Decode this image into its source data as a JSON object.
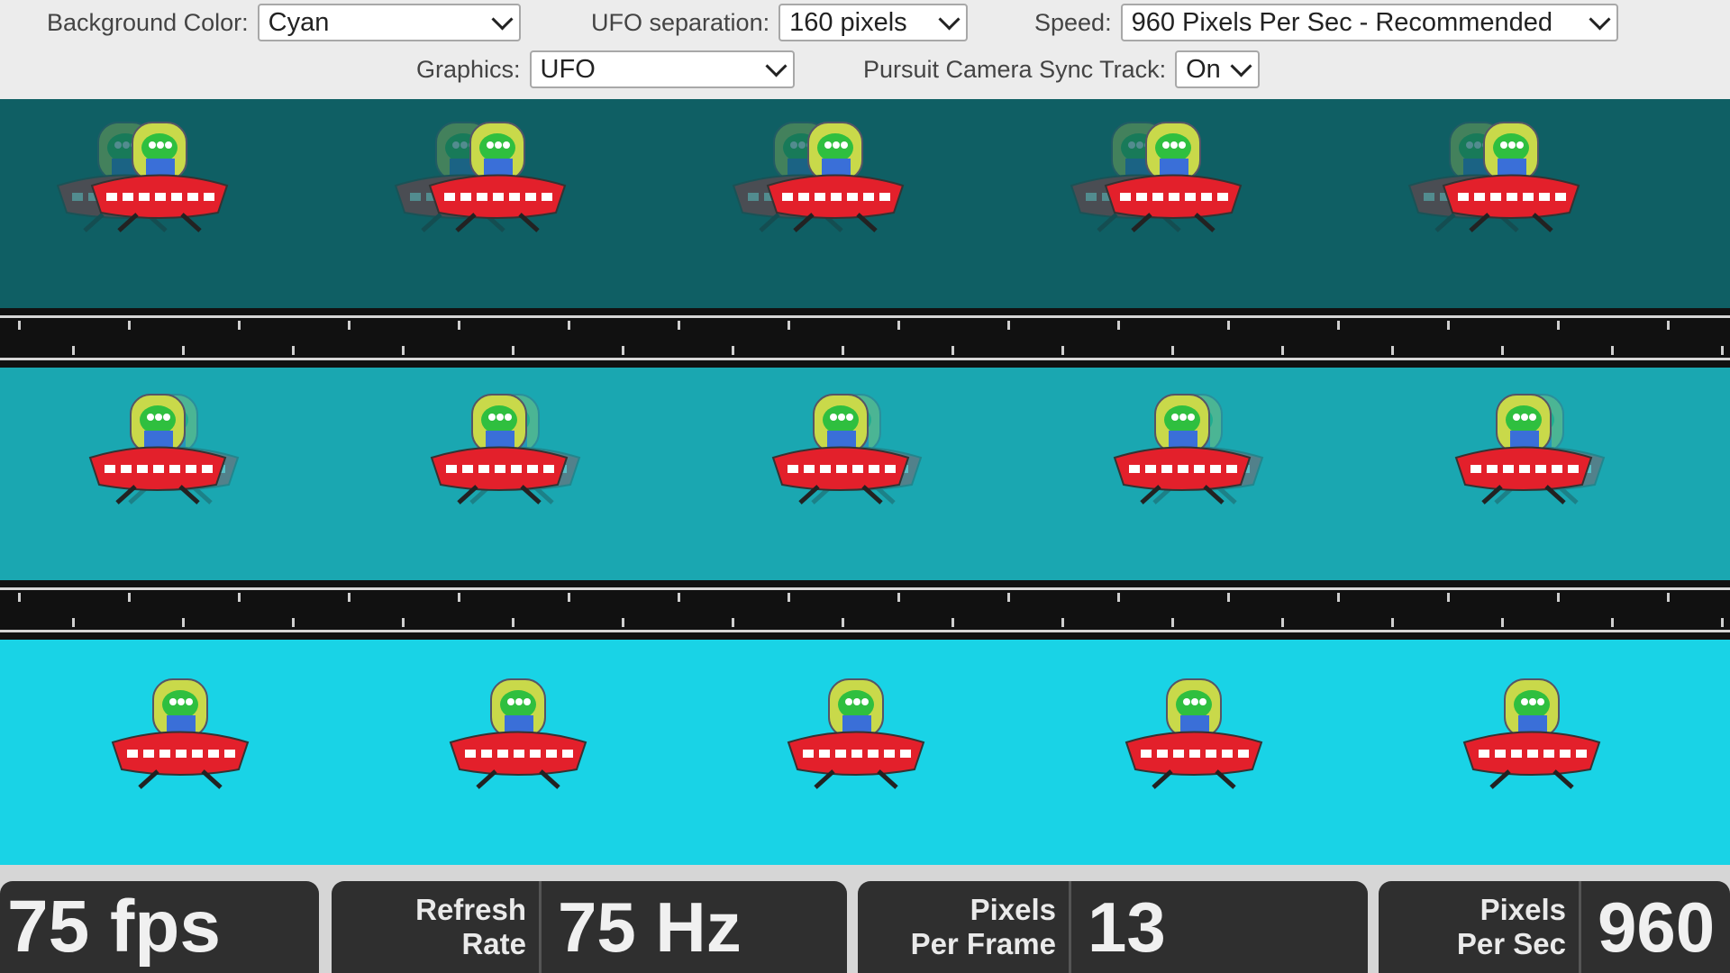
{
  "controls": {
    "background_color": {
      "label": "Background Color:",
      "value": "Cyan"
    },
    "ufo_separation": {
      "label": "UFO separation:",
      "value": "160 pixels"
    },
    "speed": {
      "label": "Speed:",
      "value": "960 Pixels Per Sec - Recommended"
    },
    "graphics": {
      "label": "Graphics:",
      "value": "UFO"
    },
    "pursuit_camera": {
      "label": "Pursuit Camera Sync Track:",
      "value": "On"
    }
  },
  "lanes": [
    {
      "name": "dark",
      "background": "#0f5f64",
      "ufo_count": 5
    },
    {
      "name": "medium",
      "background": "#1aa7b1",
      "ufo_count": 5
    },
    {
      "name": "bright",
      "background": "#19d3e6",
      "ufo_count": 5
    }
  ],
  "colors": {
    "saucer": "#e3202b",
    "alien": "#2fbf3f",
    "dome": "#c9d94a",
    "window": "#ffffff"
  },
  "stats": {
    "fps": "75 fps",
    "refresh_label_1": "Refresh",
    "refresh_label_2": "Rate",
    "refresh_value": "75 Hz",
    "ppf_label_1": "Pixels",
    "ppf_label_2": "Per Frame",
    "ppf_value": "13",
    "pps_label_1": "Pixels",
    "pps_label_2": "Per Sec",
    "pps_value": "960"
  }
}
